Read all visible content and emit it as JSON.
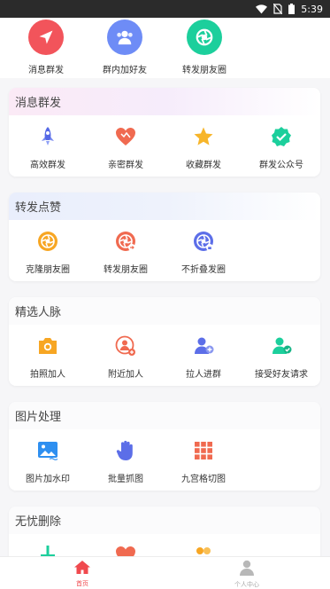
{
  "status_bar": {
    "time": "5:39"
  },
  "top_shortcuts": [
    {
      "label": "消息群发",
      "icon": "send-icon",
      "color": "#f2545b"
    },
    {
      "label": "群内加好友",
      "icon": "group-icon",
      "color": "#6e8cf6"
    },
    {
      "label": "转发朋友圈",
      "icon": "shutter-icon",
      "color": "#1ccf9c"
    }
  ],
  "sections": [
    {
      "title": "消息群发",
      "items": [
        {
          "label": "高效群发",
          "icon": "rocket-icon"
        },
        {
          "label": "亲密群发",
          "icon": "heart-icon"
        },
        {
          "label": "收藏群发",
          "icon": "star-icon"
        },
        {
          "label": "群发公众号",
          "icon": "verified-badge-icon"
        }
      ]
    },
    {
      "title": "转发点赞",
      "items": [
        {
          "label": "克隆朋友圈",
          "icon": "aperture-icon"
        },
        {
          "label": "转发朋友圈",
          "icon": "aperture-forward-icon"
        },
        {
          "label": "不折叠发圈",
          "icon": "aperture-lock-icon"
        }
      ]
    },
    {
      "title": "精选人脉",
      "items": [
        {
          "label": "拍照加人",
          "icon": "camera-icon"
        },
        {
          "label": "附近加人",
          "icon": "location-user-icon"
        },
        {
          "label": "拉人进群",
          "icon": "add-user-icon"
        },
        {
          "label": "接受好友请求",
          "icon": "user-check-icon"
        }
      ]
    },
    {
      "title": "图片处理",
      "items": [
        {
          "label": "图片加水印",
          "icon": "image-icon"
        },
        {
          "label": "批量抓图",
          "icon": "hand-icon"
        },
        {
          "label": "九宫格切图",
          "icon": "grid-icon"
        }
      ]
    },
    {
      "title": "无忧删除",
      "items": [
        {
          "label": "",
          "icon": "broom-icon"
        },
        {
          "label": "",
          "icon": "heart-delete-icon"
        },
        {
          "label": "",
          "icon": "users-delete-icon"
        }
      ]
    }
  ],
  "bottom_nav": [
    {
      "label": "首页",
      "icon": "home-icon",
      "active": true,
      "color": "#f0494e"
    },
    {
      "label": "个人中心",
      "icon": "person-icon",
      "active": false,
      "color": "#b8b8b8"
    }
  ]
}
